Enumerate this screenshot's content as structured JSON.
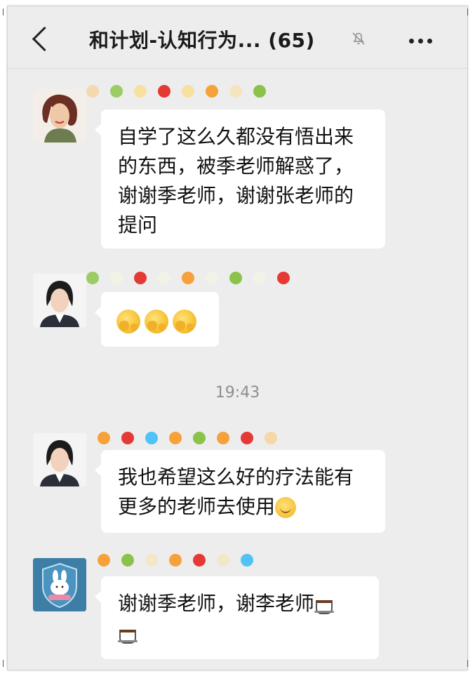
{
  "header": {
    "back_icon": "chevron-left-icon",
    "title": "和计划-认知行为... (65)",
    "mute_icon": "bell-muted-icon",
    "more_icon": "more-dots-icon"
  },
  "messages": [
    {
      "text": "自学了这么久都没有悟出来的东西，被季老师解惑了，谢谢季老师，谢谢张老师的提问"
    },
    {
      "text": "",
      "emoji": "hugging-face-emoji x3"
    },
    {
      "text": "我也希望这么好的疗法能有更多的老师去使用",
      "emoji": "smiling-face-emoji"
    },
    {
      "text": "谢谢季老师，谢李老师",
      "emoji": "hot-beverage-emoji x2"
    }
  ],
  "timestamp": "19:43",
  "colors": {
    "background": "#ededed",
    "bubble": "#ffffff",
    "name_dot_palette": [
      "#9ccc65",
      "#e53935",
      "#f7a13a",
      "#8bc34a",
      "#4fc3f7"
    ]
  }
}
